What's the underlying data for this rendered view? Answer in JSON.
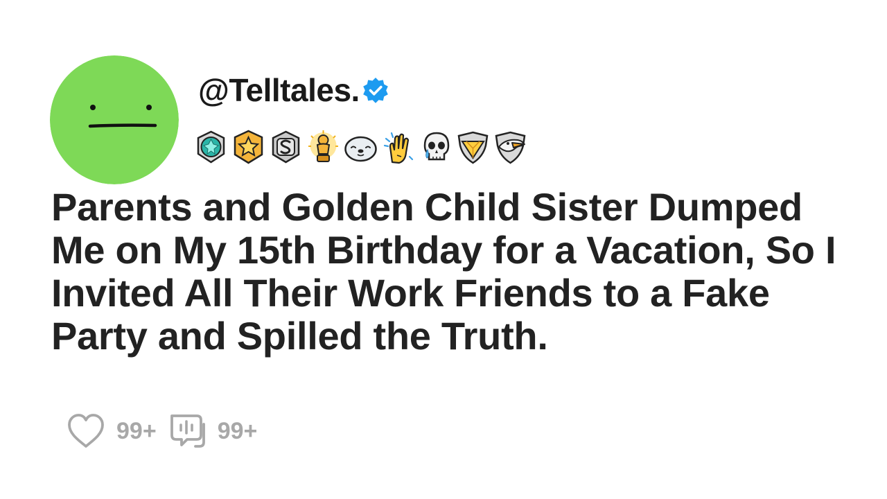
{
  "post": {
    "handle": "@Telltales.",
    "title": "Parents and Golden Child Sister Dumped Me on My 15th Birthday for a Vacation, So I Invited All Their Work Friends to a Fake Party and Spilled the Truth.",
    "likes": "99+",
    "comments": "99+"
  },
  "avatar": {
    "color": "#7ed957",
    "face": "neutral-face"
  },
  "badges": [
    "teal-gem-medal-icon",
    "gold-star-medal-icon",
    "silver-s-medal-icon",
    "gold-trophy-icon",
    "seal-face-icon",
    "clapping-hands-icon",
    "crying-skull-icon",
    "gold-diamond-shield-icon",
    "bird-shield-icon"
  ],
  "colors": {
    "verified": "#1d9bf0",
    "title_text": "#222222",
    "stat_gray": "#a8a8a8"
  }
}
